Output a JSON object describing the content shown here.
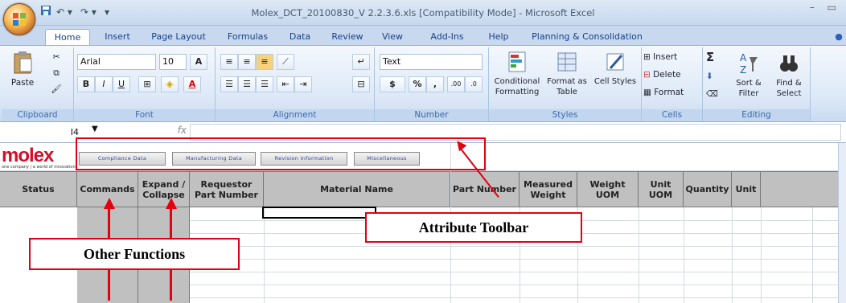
{
  "title_bar": {
    "document_title": "Molex_DCT_20100830_V 2.2.3.6.xls  [Compatibility Mode] - Microsoft Excel",
    "qat_items": [
      "save-icon",
      "undo-icon",
      "redo-icon",
      "customize-qat-icon"
    ],
    "window_controls": "– ▭"
  },
  "tabs": [
    "Home",
    "Insert",
    "Page Layout",
    "Formulas",
    "Data",
    "Review",
    "View",
    "Add-Ins",
    "Help",
    "Planning & Consolidation"
  ],
  "ribbon": {
    "clipboard": {
      "label": "Clipboard",
      "paste": "Paste"
    },
    "font": {
      "label": "Font",
      "font_name": "Arial",
      "font_size": "10",
      "bold": "B",
      "italic": "I",
      "underline": "U",
      "grow": "A",
      "shrink": "A",
      "fill_glyph": "A"
    },
    "alignment": {
      "label": "Alignment"
    },
    "number": {
      "label": "Number",
      "format": "Text",
      "currency": "$",
      "percent": "%",
      "comma": ",",
      "inc_dec": ".00",
      "dec_dec": ".0"
    },
    "styles": {
      "label": "Styles",
      "conditional": "Conditional Formatting",
      "format_table": "Format as Table",
      "cell_styles": "Cell Styles"
    },
    "cells": {
      "label": "Cells",
      "insert": "Insert",
      "delete": "Delete",
      "format": "Format"
    },
    "editing": {
      "label": "Editing",
      "sum": "Σ",
      "sort": "Sort & Filter",
      "find": "Find & Select"
    }
  },
  "formula_bar": {
    "name_box": "I4",
    "fx": "fx",
    "formula": ""
  },
  "sheet": {
    "logo": "molex",
    "logo_tagline": "one company | a world of innovation",
    "toolbar_buttons": [
      "Compliance Data",
      "Manufacturing Data",
      "Revision Information",
      "Miscellaneous"
    ],
    "headers": [
      "Status",
      "Commands",
      "Expand / Collapse",
      "Requestor Part Number",
      "Material Name",
      "Part Number",
      "Measured Weight",
      "Weight UOM",
      "Unit UOM",
      "Quantity",
      "Unit"
    ]
  },
  "annotations": {
    "toolbar": "Attribute Toolbar",
    "functions": "Other Functions"
  },
  "colors": {
    "annotation_red": "#e3000f",
    "header_gray": "#c0c0c0",
    "ribbon_blue": "#dce8f7"
  }
}
